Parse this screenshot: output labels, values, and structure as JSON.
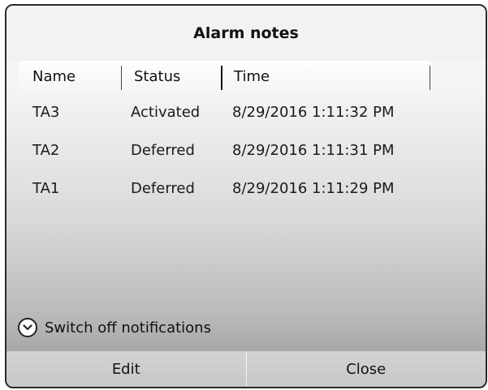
{
  "dialog": {
    "title": "Alarm notes"
  },
  "table": {
    "columns": [
      "Name",
      "Status",
      "Time"
    ],
    "rows": [
      {
        "name": "TA3",
        "status": "Activated",
        "time": "8/29/2016 1:11:32 PM"
      },
      {
        "name": "TA2",
        "status": "Deferred",
        "time": "8/29/2016 1:11:31 PM"
      },
      {
        "name": "TA1",
        "status": "Deferred",
        "time": "8/29/2016 1:11:29 PM"
      }
    ]
  },
  "toggle": {
    "label": "Switch off notifications",
    "icon": "chevron-down-icon"
  },
  "buttons": {
    "edit": "Edit",
    "close": "Close"
  }
}
